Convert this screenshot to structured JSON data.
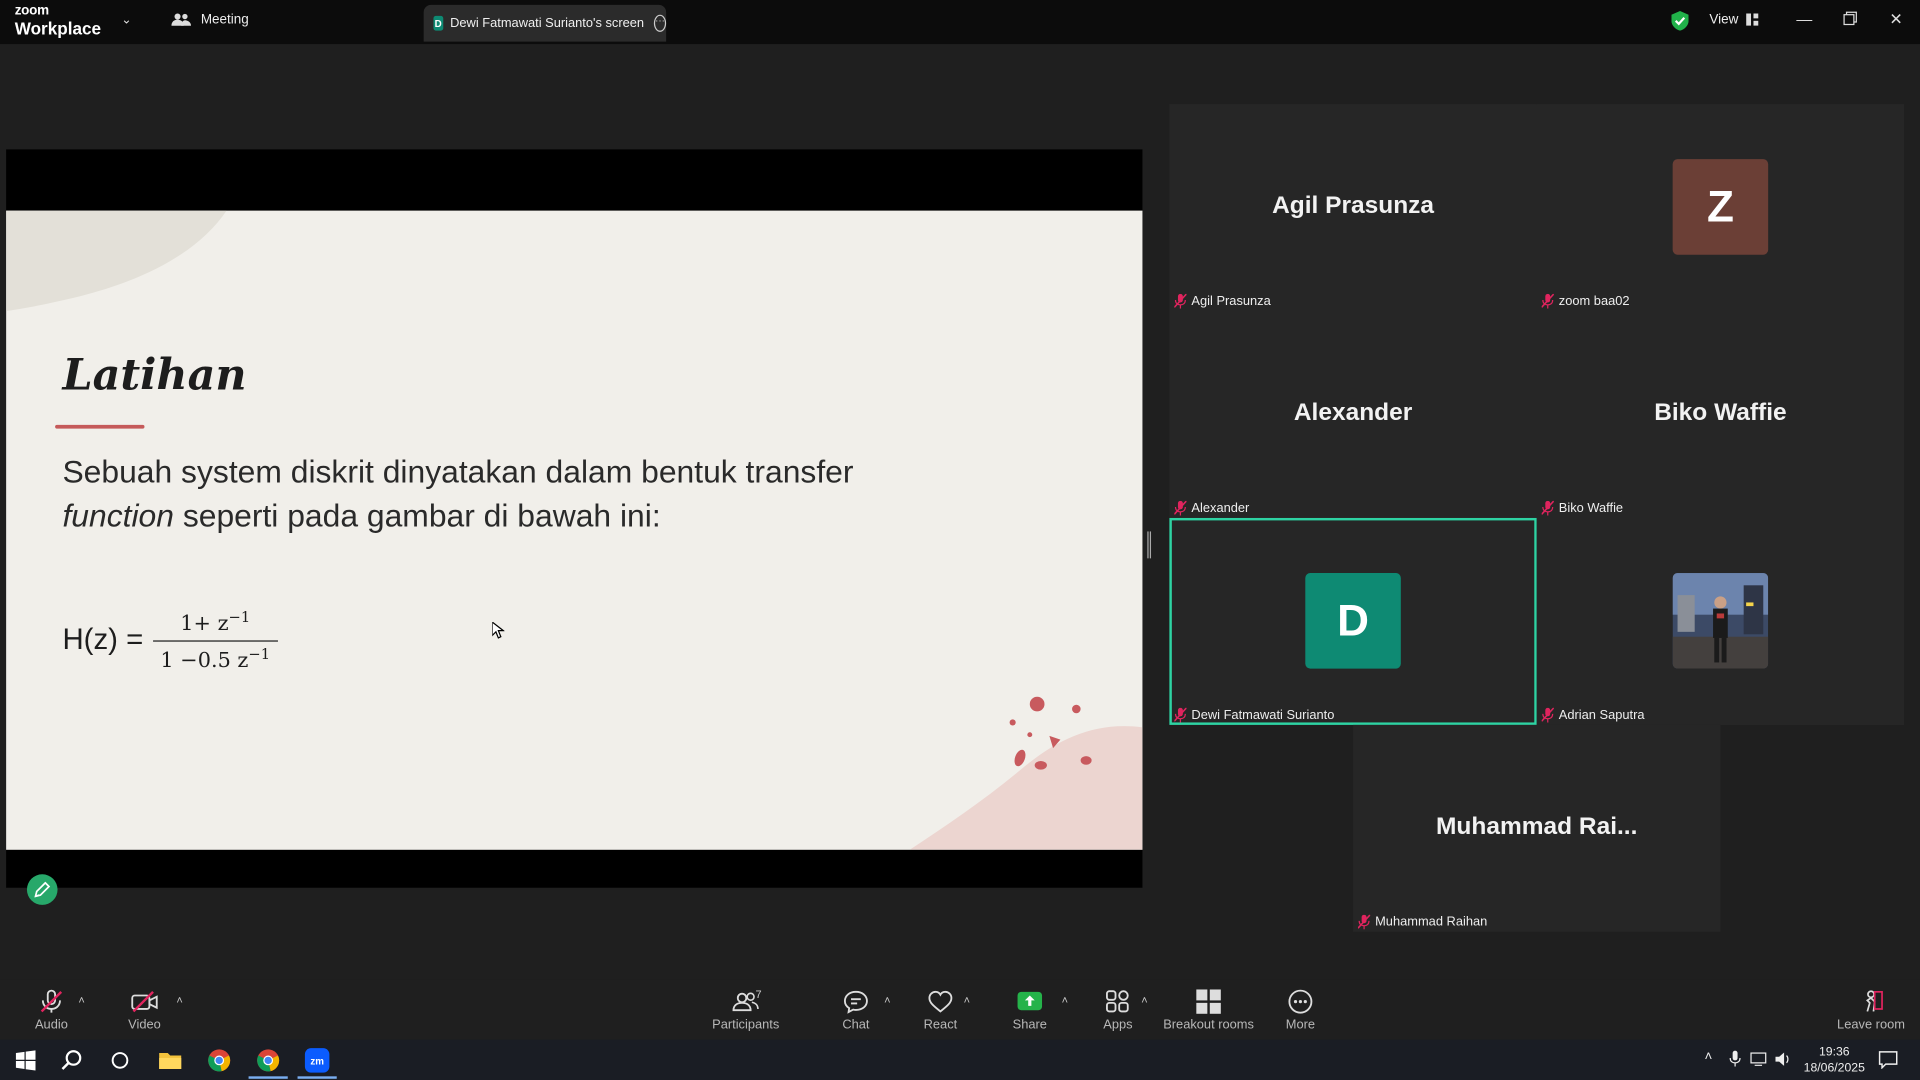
{
  "titlebar": {
    "logo_line1": "zoom",
    "logo_line2": "Workplace",
    "meeting_tab": "Meeting",
    "share_tab": "Dewi Fatmawati Surianto's screen",
    "share_initial": "D",
    "view_label": "View"
  },
  "slide": {
    "title": "Latihan",
    "body_line1": "Sebuah system diskrit dinyatakan dalam bentuk transfer",
    "body_line2_italic": "function",
    "body_line2_rest": " seperti pada gambar di bawah ini:",
    "formula_lhs": "H(z) =",
    "formula_num": "1+ z",
    "formula_den": "1 −0.5 z",
    "formula_exp": "−1"
  },
  "gallery": {
    "tiles": [
      {
        "display": "Agil Prasunza",
        "label": "Agil Prasunza"
      },
      {
        "display": "Z",
        "label": "zoom baa02",
        "color": "#6b3f36"
      },
      {
        "display": "Alexander",
        "label": "Alexander"
      },
      {
        "display": "Biko Waffie",
        "label": "Biko Waffie"
      },
      {
        "display": "D",
        "label": "Dewi Fatmawati Surianto",
        "color": "#0e8a73"
      },
      {
        "display": "",
        "label": "Adrian Saputra"
      },
      {
        "display": "Muhammad  Rai...",
        "label": "Muhammad Raihan"
      }
    ]
  },
  "toolbar": {
    "audio": "Audio",
    "video": "Video",
    "participants": "Participants",
    "participants_count": "7",
    "chat": "Chat",
    "react": "React",
    "share": "Share",
    "apps": "Apps",
    "breakout": "Breakout rooms",
    "more": "More",
    "leave": "Leave room"
  },
  "taskbar": {
    "time": "19:36",
    "date": "18/06/2025"
  },
  "colors": {
    "accent_green": "#2ed3a3",
    "share_green": "#25b34a",
    "muted_red": "#e0245e"
  }
}
